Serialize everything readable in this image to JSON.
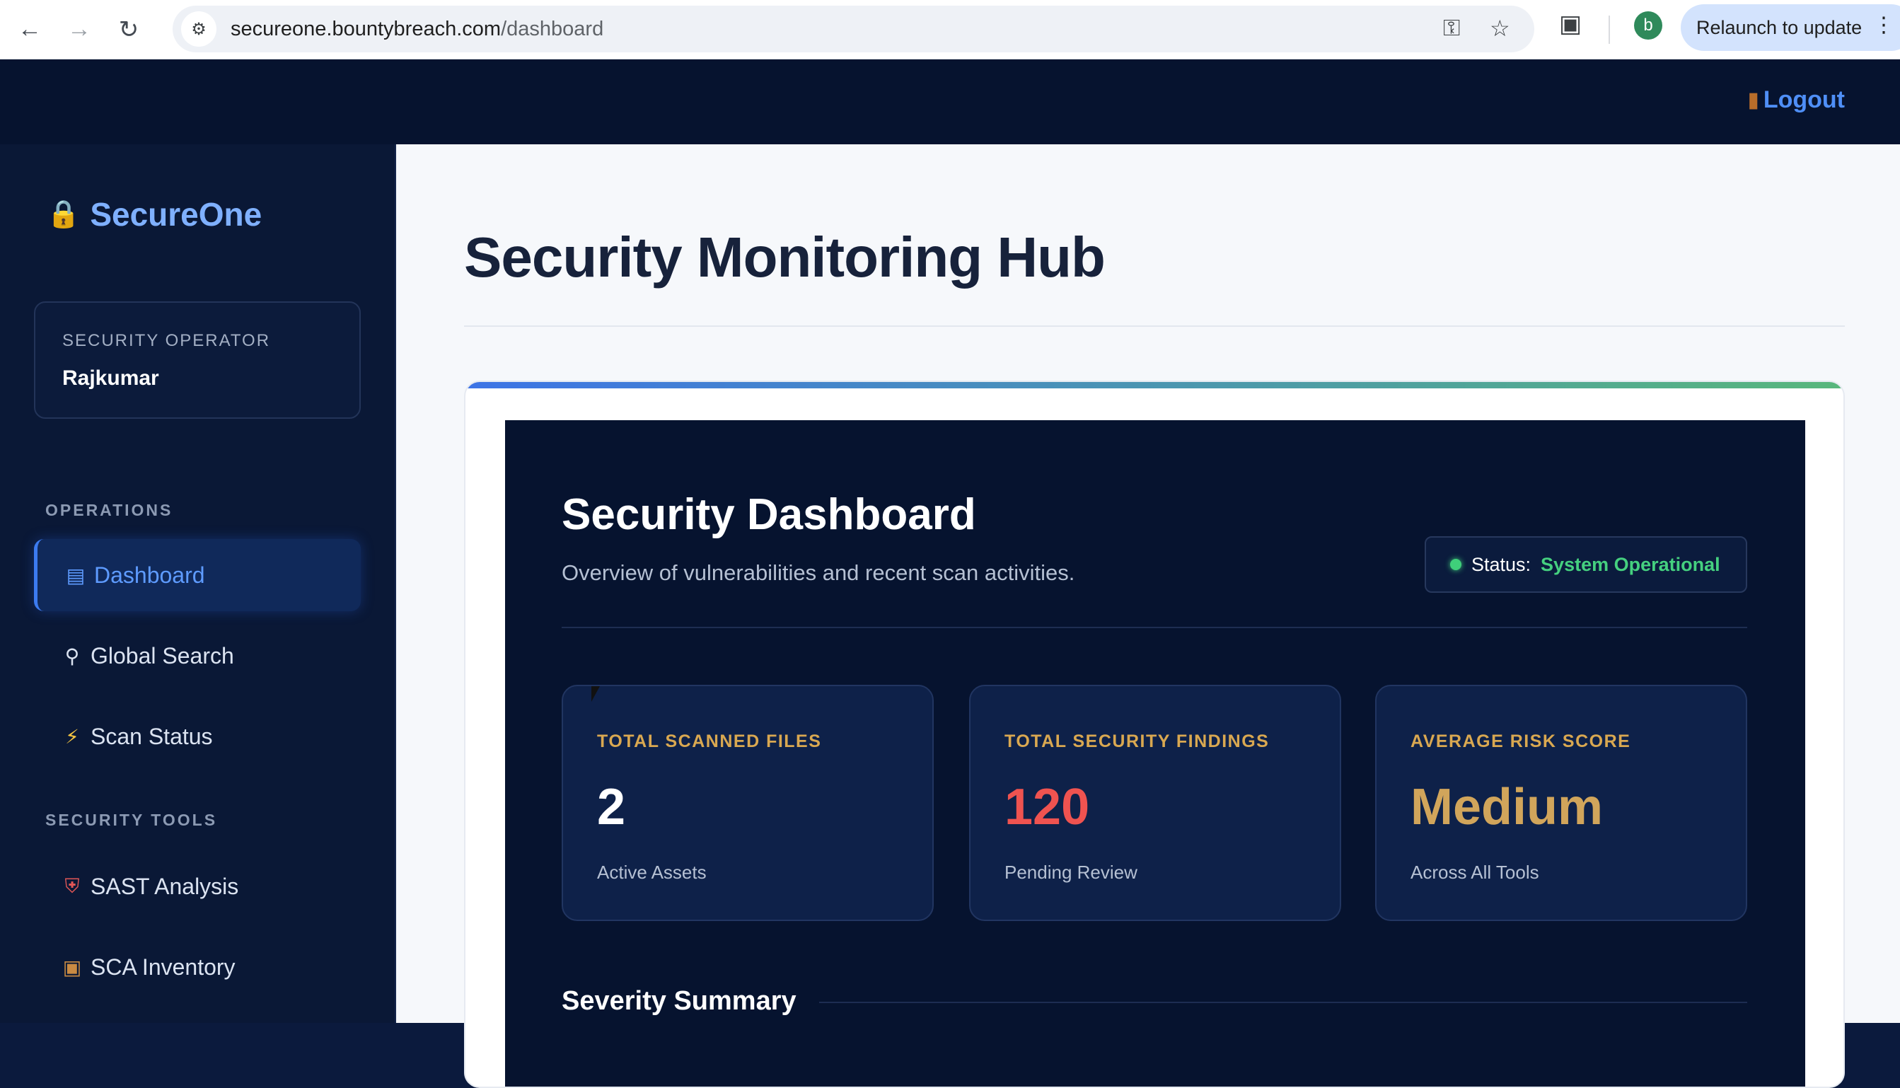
{
  "browser": {
    "url_host": "secureone.bountybreach.com",
    "url_path": "/dashboard",
    "profile_initial": "b",
    "relaunch_label": "Relaunch to update"
  },
  "header": {
    "logout_label": "Logout"
  },
  "sidebar": {
    "brand": "SecureOne",
    "operator_role": "SECURITY OPERATOR",
    "operator_name": "Rajkumar",
    "sections": [
      {
        "label": "OPERATIONS",
        "items": [
          {
            "label": "Dashboard",
            "icon": "bar-chart-icon",
            "active": true
          },
          {
            "label": "Global Search",
            "icon": "magnifier-icon"
          },
          {
            "label": "Scan Status",
            "icon": "lightning-icon"
          }
        ]
      },
      {
        "label": "SECURITY TOOLS",
        "items": [
          {
            "label": "SAST Analysis",
            "icon": "shield-icon"
          },
          {
            "label": "SCA Inventory",
            "icon": "package-icon"
          }
        ]
      }
    ]
  },
  "main": {
    "page_title": "Security Monitoring Hub",
    "dashboard": {
      "title": "Security Dashboard",
      "subtitle": "Overview of vulnerabilities and recent scan activities.",
      "status_prefix": "Status:",
      "status_value": "System Operational",
      "metrics": [
        {
          "label": "TOTAL SCANNED FILES",
          "value": "2",
          "note": "Active Assets",
          "color": "#ffffff"
        },
        {
          "label": "TOTAL SECURITY FINDINGS",
          "value": "120",
          "note": "Pending Review",
          "color": "#ef5350"
        },
        {
          "label": "AVERAGE RISK SCORE",
          "value": "Medium",
          "note": "Across All Tools",
          "color": "#d1a55b"
        }
      ],
      "summary_title": "Severity Summary"
    }
  },
  "colors": {
    "accent_blue": "#3c7bf0",
    "success_green": "#45d07f",
    "brand_blue": "#7fb0ff",
    "navy": "#06132f"
  }
}
